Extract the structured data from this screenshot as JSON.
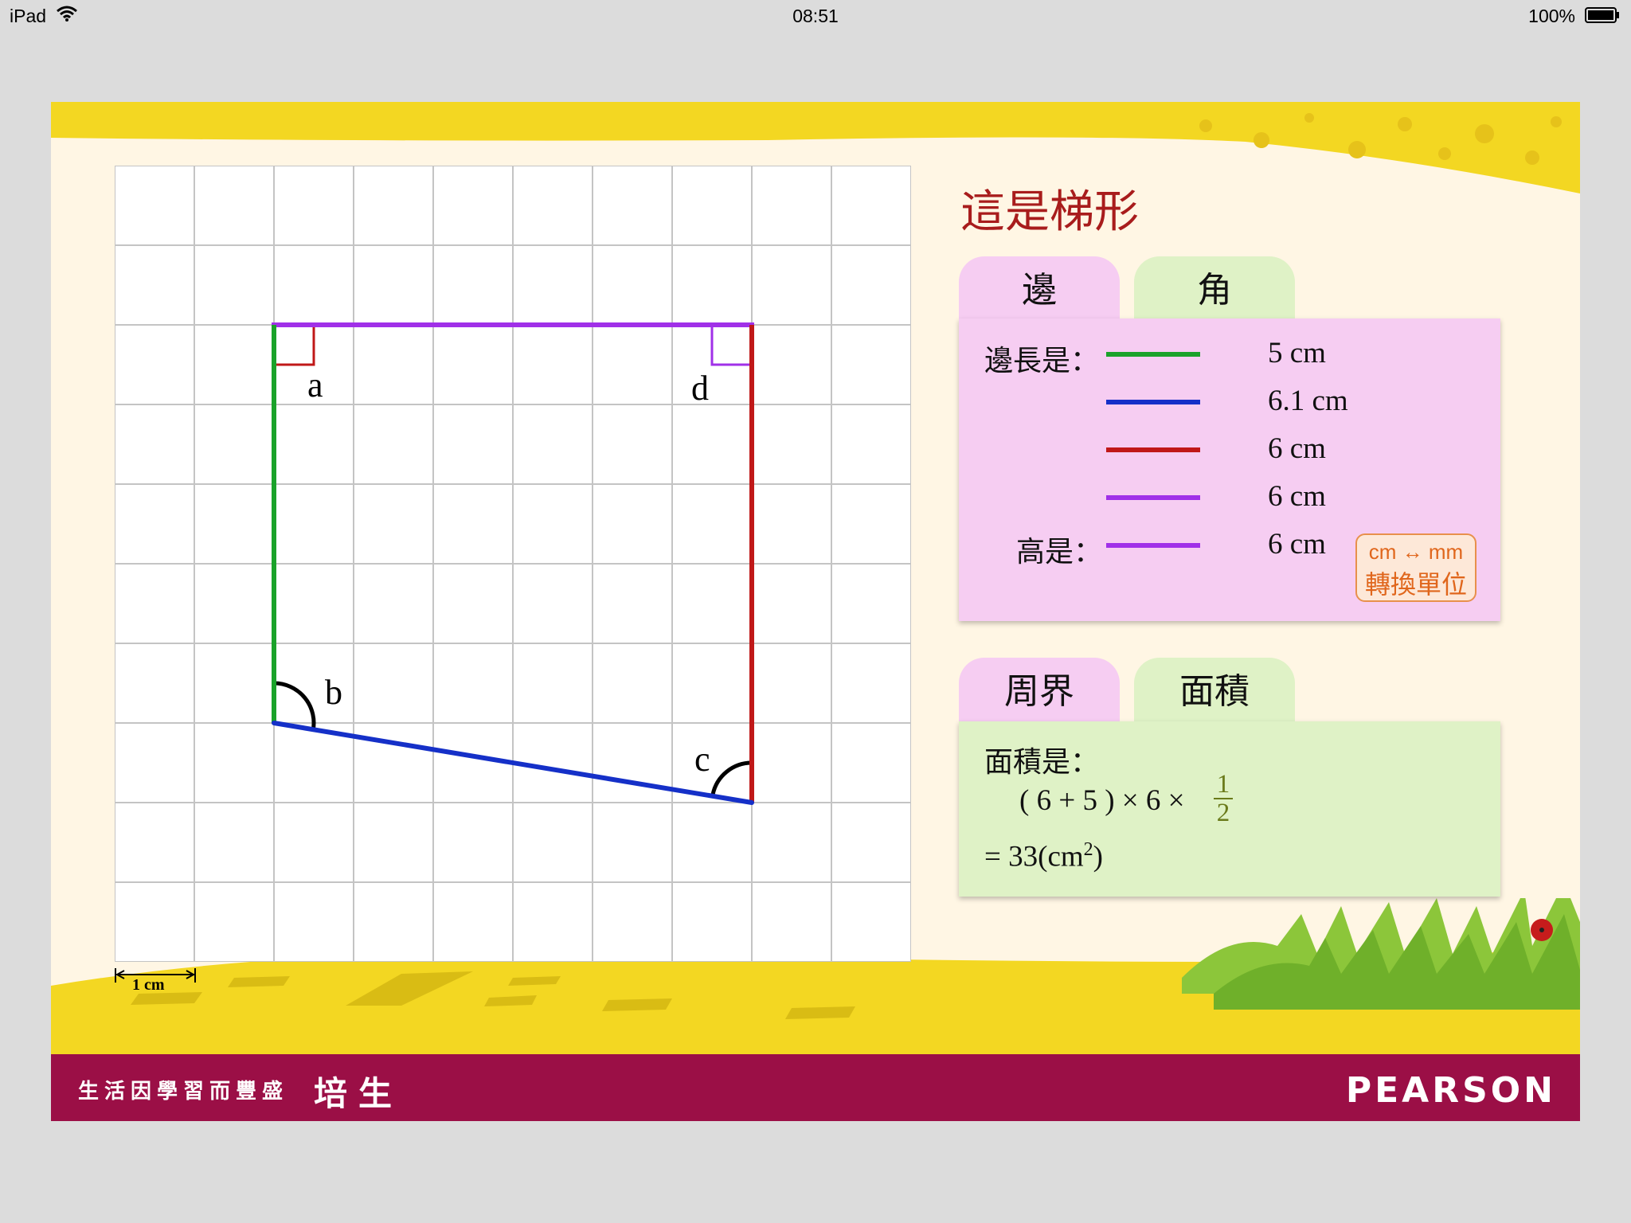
{
  "status_bar": {
    "device": "iPad",
    "time": "08:51",
    "battery": "100%"
  },
  "shape": {
    "title": "這是梯形",
    "vertices": {
      "a": "a",
      "b": "b",
      "c": "c",
      "d": "d"
    }
  },
  "scale": {
    "label": "1 cm"
  },
  "tabs_top": [
    {
      "label": "邊",
      "active": true
    },
    {
      "label": "角",
      "active": false
    }
  ],
  "sides": {
    "side_label": "邊長是：",
    "height_label": "高是：",
    "rows": [
      {
        "value": "5 cm",
        "color": "#1aa22a"
      },
      {
        "value": "6.1 cm",
        "color": "#1530c8"
      },
      {
        "value": "6 cm",
        "color": "#c01818"
      },
      {
        "value": "6 cm",
        "color": "#a030e8"
      }
    ],
    "height": {
      "value": "6 cm",
      "color": "#a030e8"
    }
  },
  "unit_button": {
    "line1": "cm ↔ mm",
    "line2": "轉換單位"
  },
  "tabs_bottom": [
    {
      "label": "周界",
      "active": false
    },
    {
      "label": "面積",
      "active": true
    }
  ],
  "area": {
    "label": "面積是：",
    "formula": "( 6 + 5 ) × 6 ×",
    "fraction_num": "1",
    "fraction_den": "2",
    "result_prefix": "= 33(cm",
    "result_sup": "2",
    "result_suffix": ")"
  },
  "footer": {
    "slogan": "生活因學習而豐盛",
    "brand_cn": "培生",
    "brand_en": "PEARSON"
  },
  "colors": {
    "side_green": "#1aa22a",
    "side_blue": "#1530c8",
    "side_red": "#c01818",
    "side_purple": "#a030e8",
    "title_red": "#a81c1c",
    "footer_bg": "#9b0f46"
  }
}
